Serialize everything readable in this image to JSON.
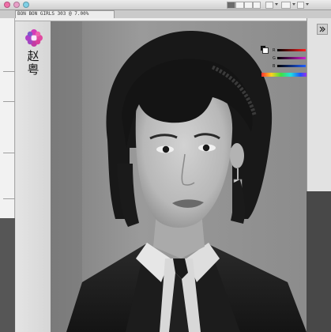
{
  "document": {
    "title": "BON BON GIRLS 303 @ 7.00%"
  },
  "name_card": {
    "name": "赵粤"
  },
  "color_panel": {
    "labels": [
      "R",
      "G",
      "B"
    ],
    "values": [
      "0",
      "0",
      "0"
    ]
  },
  "colors": {
    "close": "#f06fa8",
    "minimize": "#e8a0c8",
    "zoom": "#7fd0e6"
  }
}
